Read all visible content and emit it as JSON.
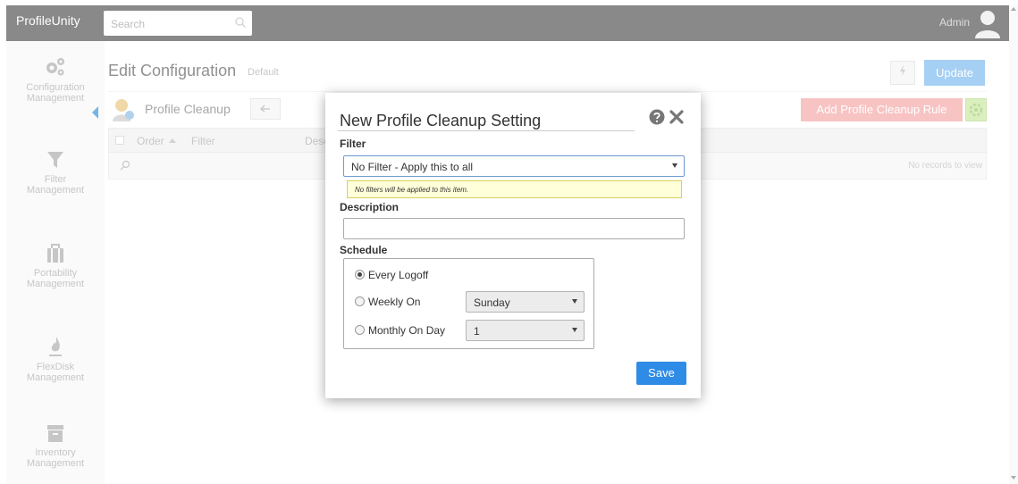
{
  "app": {
    "brand": "ProfileUnity",
    "search_placeholder": "Search",
    "user": "Admin"
  },
  "sidebar": {
    "items": [
      {
        "label_line1": "Configuration",
        "label_line2": "Management"
      },
      {
        "label_line1": "Filter",
        "label_line2": "Management"
      },
      {
        "label_line1": "Portability",
        "label_line2": "Management"
      },
      {
        "label_line1": "FlexDisk",
        "label_line2": "Management"
      },
      {
        "label_line1": "Inventory",
        "label_line2": "Management"
      }
    ]
  },
  "page": {
    "title": "Edit Configuration",
    "subtitle": "Default",
    "update_label": "Update",
    "section_title": "Profile Cleanup",
    "add_rule_label": "Add Profile Cleanup Rule",
    "grid": {
      "columns": [
        "Order",
        "Filter",
        "Desc"
      ],
      "empty_text": "No records to view"
    }
  },
  "modal": {
    "title": "New Profile Cleanup Setting",
    "filter_label": "Filter",
    "filter_value": "No Filter - Apply this to all",
    "filter_note": "No filters will be applied to this item.",
    "description_label": "Description",
    "description_value": "",
    "schedule_label": "Schedule",
    "schedule": {
      "every_logoff": "Every Logoff",
      "weekly_on": "Weekly On",
      "weekly_value": "Sunday",
      "monthly_on_day": "Monthly On Day",
      "monthly_value": "1",
      "selected": "every_logoff"
    },
    "save_label": "Save"
  },
  "colors": {
    "topbar": "#4a4a4a",
    "accent": "#2f8ce6",
    "add_rule": "#f5a3a3",
    "note_bg": "#ffffd9"
  }
}
